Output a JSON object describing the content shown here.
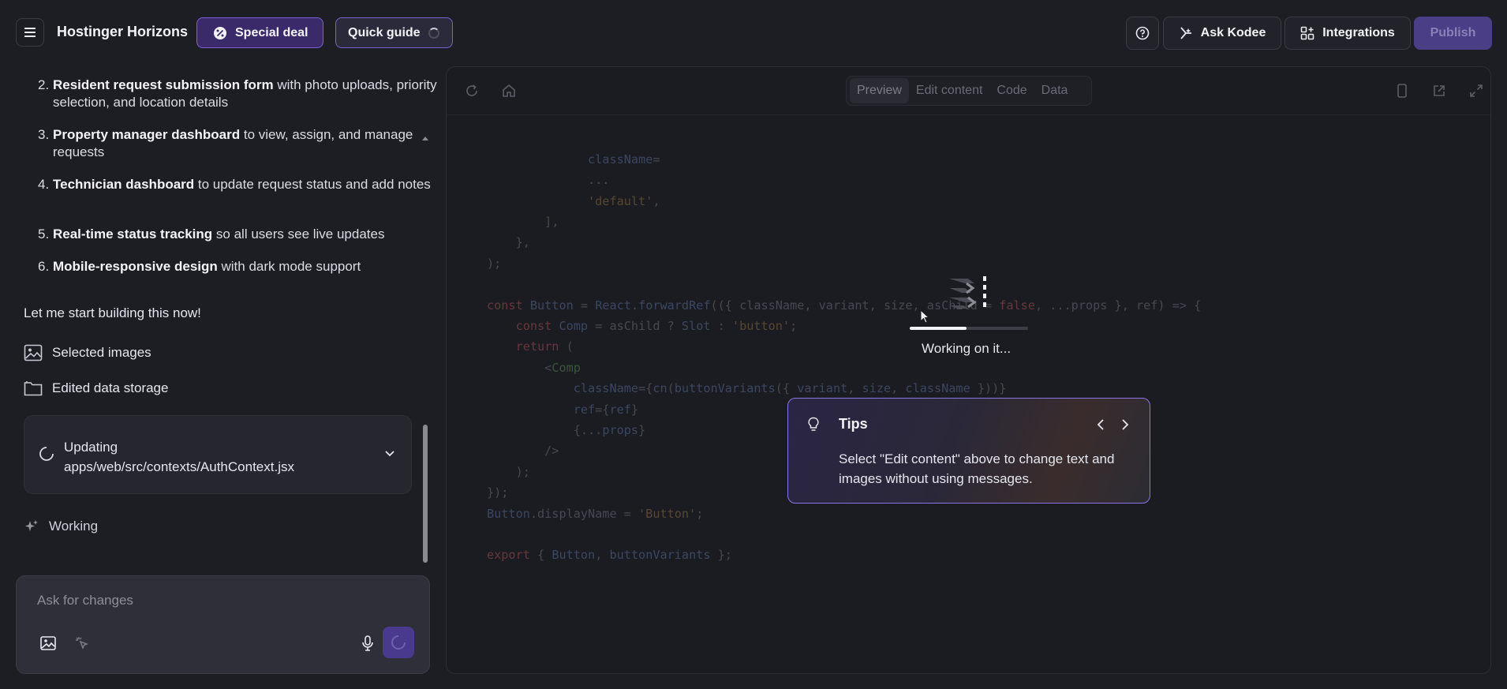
{
  "header": {
    "app_title": "Hostinger Horizons",
    "special_deal": "Special deal",
    "quick_guide": "Quick guide",
    "ask_kodee": "Ask Kodee",
    "integrations": "Integrations",
    "publish": "Publish"
  },
  "chat": {
    "steps": [
      {
        "num": "2.",
        "bold": "Resident request submission form",
        "rest": " with photo uploads, priority selection, and location details"
      },
      {
        "num": "3.",
        "bold": "Property manager dashboard",
        "rest": " to view, assign, and manage requests"
      },
      {
        "num": "4.",
        "bold": "Technician dashboard",
        "rest": " to update request status and add notes"
      },
      {
        "num": "5.",
        "bold": "Real-time status tracking",
        "rest": " so all users see live updates"
      },
      {
        "num": "6.",
        "bold": "Mobile-responsive design",
        "rest": " with dark mode support"
      }
    ],
    "message": "Let me start building this now!",
    "attachments": [
      "Selected images",
      "Edited data storage"
    ],
    "updating_label": "Updating",
    "updating_path": "apps/web/src/contexts/AuthContext.jsx",
    "working": "Working",
    "input_placeholder": "Ask for changes"
  },
  "preview": {
    "tabs": [
      "Preview",
      "Edit content",
      "Code",
      "Data"
    ],
    "active_tab": "Preview",
    "code_lines": [
      {
        "html": "              <span class=\"f\">className</span>=",
        "row": 0.75
      },
      {
        "html": "              ...",
        "row": 1.75
      },
      {
        "html": "              <span class=\"s\">'default'</span>,",
        "row": 2.75
      },
      {
        "html": "        ],",
        "row": 3.75
      },
      {
        "html": "    },",
        "row": 4.75
      },
      {
        "html": ");",
        "row": 5.75
      },
      {
        "html": "<span class=\"k\">const</span> <span class=\"f\">Button</span> = <span class=\"f\">React</span>.<span class=\"f\">forwardRef</span>(({ className, variant, size, asChild = <span class=\"k\">false</span>, ...props }, ref) => {",
        "row": 7.75
      },
      {
        "html": "    <span class=\"k\">const</span> <span class=\"f\">Comp</span> = asChild ? <span class=\"f\">Slot</span> : <span class=\"s\">'button'</span>;",
        "row": 8.75
      },
      {
        "html": "    <span class=\"k\">return</span> (",
        "row": 9.75
      },
      {
        "html": "        &lt;<span class=\"g\">Comp</span>",
        "row": 10.75
      },
      {
        "html": "            <span class=\"f\">className</span>={<span class=\"f\">cn</span>(<span class=\"f\">buttonVariants</span>({ <span class=\"f\">variant</span>, <span class=\"f\">size</span>, <span class=\"f\">className</span> }))}",
        "row": 11.75
      },
      {
        "html": "            <span class=\"f\">ref</span>={<span class=\"f\">ref</span>}",
        "row": 12.75
      },
      {
        "html": "            {...<span class=\"f\">props</span>}",
        "row": 13.75
      },
      {
        "html": "        /&gt;",
        "row": 14.75
      },
      {
        "html": "    );",
        "row": 15.75
      },
      {
        "html": "});",
        "row": 16.75
      },
      {
        "html": "<span class=\"f\">Button</span>.displayName = <span class=\"s\">'Button'</span>;",
        "row": 17.75
      },
      {
        "html": "<span class=\"k\">export</span> { <span class=\"f\">Button</span>, <span class=\"f\">buttonVariants</span> };",
        "row": 19.75
      }
    ],
    "working_label": "Working on it...",
    "progress_fraction": 0.48
  },
  "tips": {
    "title": "Tips",
    "body": "Select \"Edit content\" above to change text and images without using messages."
  },
  "colors": {
    "accent": "#7a62d6",
    "publish_bg": "#4a3e86",
    "background": "#1d1e24"
  }
}
